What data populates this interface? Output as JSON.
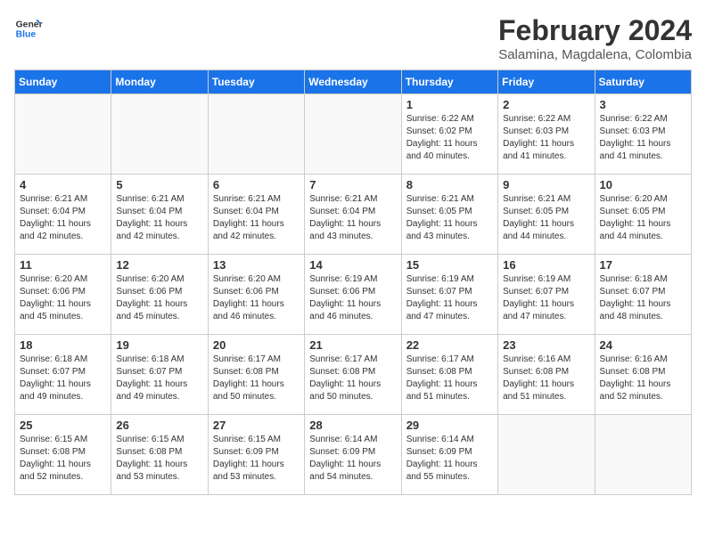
{
  "logo": {
    "line1": "General",
    "line2": "Blue"
  },
  "title": "February 2024",
  "location": "Salamina, Magdalena, Colombia",
  "days_of_week": [
    "Sunday",
    "Monday",
    "Tuesday",
    "Wednesday",
    "Thursday",
    "Friday",
    "Saturday"
  ],
  "weeks": [
    [
      {
        "day": "",
        "info": ""
      },
      {
        "day": "",
        "info": ""
      },
      {
        "day": "",
        "info": ""
      },
      {
        "day": "",
        "info": ""
      },
      {
        "day": "1",
        "info": "Sunrise: 6:22 AM\nSunset: 6:02 PM\nDaylight: 11 hours\nand 40 minutes."
      },
      {
        "day": "2",
        "info": "Sunrise: 6:22 AM\nSunset: 6:03 PM\nDaylight: 11 hours\nand 41 minutes."
      },
      {
        "day": "3",
        "info": "Sunrise: 6:22 AM\nSunset: 6:03 PM\nDaylight: 11 hours\nand 41 minutes."
      }
    ],
    [
      {
        "day": "4",
        "info": "Sunrise: 6:21 AM\nSunset: 6:04 PM\nDaylight: 11 hours\nand 42 minutes."
      },
      {
        "day": "5",
        "info": "Sunrise: 6:21 AM\nSunset: 6:04 PM\nDaylight: 11 hours\nand 42 minutes."
      },
      {
        "day": "6",
        "info": "Sunrise: 6:21 AM\nSunset: 6:04 PM\nDaylight: 11 hours\nand 42 minutes."
      },
      {
        "day": "7",
        "info": "Sunrise: 6:21 AM\nSunset: 6:04 PM\nDaylight: 11 hours\nand 43 minutes."
      },
      {
        "day": "8",
        "info": "Sunrise: 6:21 AM\nSunset: 6:05 PM\nDaylight: 11 hours\nand 43 minutes."
      },
      {
        "day": "9",
        "info": "Sunrise: 6:21 AM\nSunset: 6:05 PM\nDaylight: 11 hours\nand 44 minutes."
      },
      {
        "day": "10",
        "info": "Sunrise: 6:20 AM\nSunset: 6:05 PM\nDaylight: 11 hours\nand 44 minutes."
      }
    ],
    [
      {
        "day": "11",
        "info": "Sunrise: 6:20 AM\nSunset: 6:06 PM\nDaylight: 11 hours\nand 45 minutes."
      },
      {
        "day": "12",
        "info": "Sunrise: 6:20 AM\nSunset: 6:06 PM\nDaylight: 11 hours\nand 45 minutes."
      },
      {
        "day": "13",
        "info": "Sunrise: 6:20 AM\nSunset: 6:06 PM\nDaylight: 11 hours\nand 46 minutes."
      },
      {
        "day": "14",
        "info": "Sunrise: 6:19 AM\nSunset: 6:06 PM\nDaylight: 11 hours\nand 46 minutes."
      },
      {
        "day": "15",
        "info": "Sunrise: 6:19 AM\nSunset: 6:07 PM\nDaylight: 11 hours\nand 47 minutes."
      },
      {
        "day": "16",
        "info": "Sunrise: 6:19 AM\nSunset: 6:07 PM\nDaylight: 11 hours\nand 47 minutes."
      },
      {
        "day": "17",
        "info": "Sunrise: 6:18 AM\nSunset: 6:07 PM\nDaylight: 11 hours\nand 48 minutes."
      }
    ],
    [
      {
        "day": "18",
        "info": "Sunrise: 6:18 AM\nSunset: 6:07 PM\nDaylight: 11 hours\nand 49 minutes."
      },
      {
        "day": "19",
        "info": "Sunrise: 6:18 AM\nSunset: 6:07 PM\nDaylight: 11 hours\nand 49 minutes."
      },
      {
        "day": "20",
        "info": "Sunrise: 6:17 AM\nSunset: 6:08 PM\nDaylight: 11 hours\nand 50 minutes."
      },
      {
        "day": "21",
        "info": "Sunrise: 6:17 AM\nSunset: 6:08 PM\nDaylight: 11 hours\nand 50 minutes."
      },
      {
        "day": "22",
        "info": "Sunrise: 6:17 AM\nSunset: 6:08 PM\nDaylight: 11 hours\nand 51 minutes."
      },
      {
        "day": "23",
        "info": "Sunrise: 6:16 AM\nSunset: 6:08 PM\nDaylight: 11 hours\nand 51 minutes."
      },
      {
        "day": "24",
        "info": "Sunrise: 6:16 AM\nSunset: 6:08 PM\nDaylight: 11 hours\nand 52 minutes."
      }
    ],
    [
      {
        "day": "25",
        "info": "Sunrise: 6:15 AM\nSunset: 6:08 PM\nDaylight: 11 hours\nand 52 minutes."
      },
      {
        "day": "26",
        "info": "Sunrise: 6:15 AM\nSunset: 6:08 PM\nDaylight: 11 hours\nand 53 minutes."
      },
      {
        "day": "27",
        "info": "Sunrise: 6:15 AM\nSunset: 6:09 PM\nDaylight: 11 hours\nand 53 minutes."
      },
      {
        "day": "28",
        "info": "Sunrise: 6:14 AM\nSunset: 6:09 PM\nDaylight: 11 hours\nand 54 minutes."
      },
      {
        "day": "29",
        "info": "Sunrise: 6:14 AM\nSunset: 6:09 PM\nDaylight: 11 hours\nand 55 minutes."
      },
      {
        "day": "",
        "info": ""
      },
      {
        "day": "",
        "info": ""
      }
    ]
  ]
}
